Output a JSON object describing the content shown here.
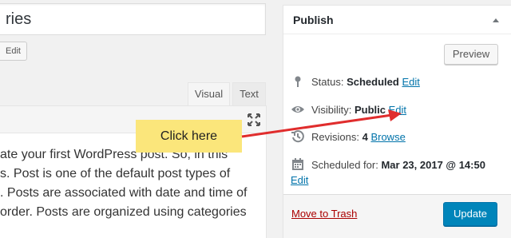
{
  "post": {
    "title_fragment": "ries",
    "edit_slug_label": "Edit"
  },
  "editor": {
    "tabs": [
      "Visual",
      "Text"
    ],
    "content_lines": [
      "ate your first WordPress post. So, in this",
      "s. Post is one of the default post types of",
      ". Posts are associated with date and time of",
      "order. Posts are organized using categories"
    ]
  },
  "publish": {
    "title": "Publish",
    "preview_label": "Preview",
    "status": {
      "label": "Status:",
      "value": "Scheduled",
      "edit": "Edit"
    },
    "visibility": {
      "label": "Visibility:",
      "value": "Public",
      "edit": "Edit"
    },
    "revisions": {
      "label": "Revisions:",
      "value": "4",
      "link": "Browse"
    },
    "schedule": {
      "label": "Scheduled for:",
      "value": "Mar 23, 2017 @ 14:50",
      "edit": "Edit"
    },
    "trash_label": "Move to Trash",
    "update_label": "Update"
  },
  "annotation": {
    "callout_text": "Click here",
    "callout_color": "#fbe67b",
    "arrow_color": "#e02d2d"
  },
  "colors": {
    "link": "#0073aa",
    "primary_button": "#0085ba",
    "trash": "#a00000"
  }
}
